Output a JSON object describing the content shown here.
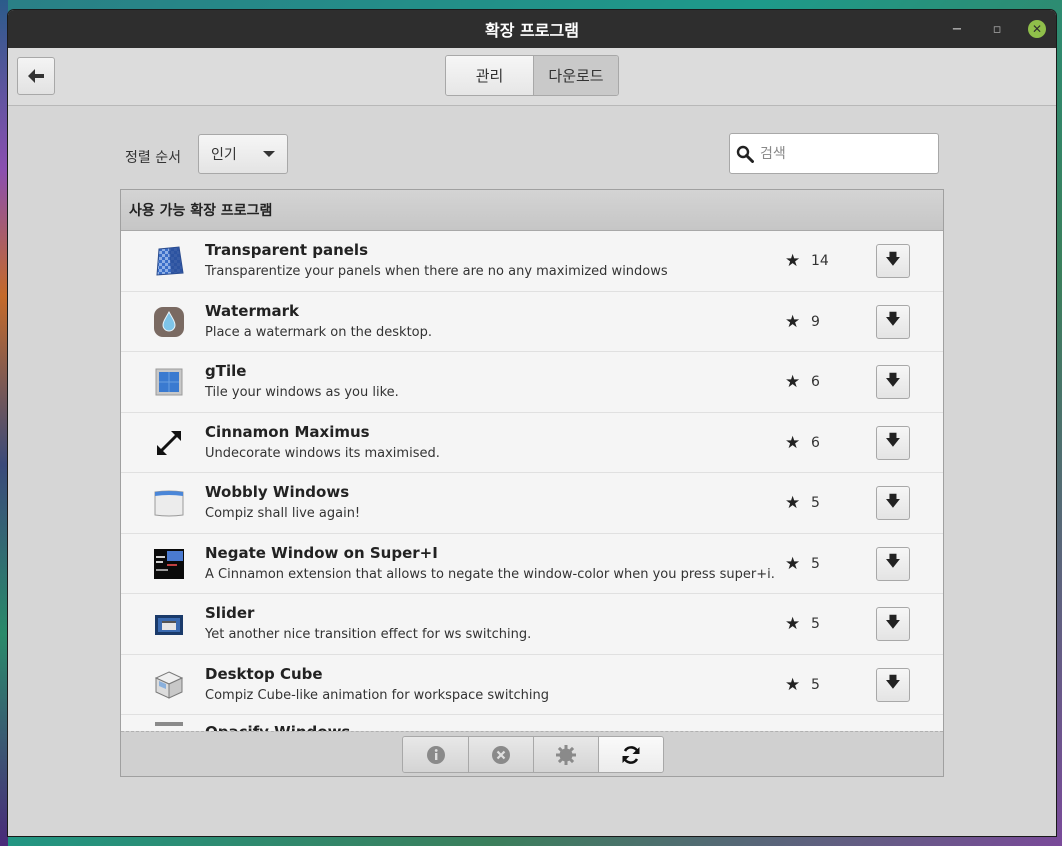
{
  "window": {
    "title": "확장 프로그램"
  },
  "window_controls": {
    "minimize": "−",
    "restore": "▫",
    "close": "✕"
  },
  "toolbar": {
    "back_icon": "arrow-left-icon",
    "tabs": [
      {
        "label": "관리",
        "active": false
      },
      {
        "label": "다운로드",
        "active": true
      }
    ]
  },
  "sort": {
    "label": "정렬 순서",
    "value": "인기"
  },
  "search": {
    "placeholder": "검색",
    "value": ""
  },
  "panel": {
    "header": "사용 가능 확장 프로그램",
    "items": [
      {
        "title": "Transparent panels",
        "description": "Transparentize your panels when there are no any maximized windows",
        "score": "14",
        "icon": "transparent-panels-icon"
      },
      {
        "title": "Watermark",
        "description": "Place a watermark on the desktop.",
        "score": "9",
        "icon": "watermark-icon"
      },
      {
        "title": "gTile",
        "description": "Tile your windows as you like.",
        "score": "6",
        "icon": "gtile-icon"
      },
      {
        "title": "Cinnamon Maximus",
        "description": "Undecorate windows its maximised.",
        "score": "6",
        "icon": "maximus-icon"
      },
      {
        "title": "Wobbly Windows",
        "description": "Compiz shall live again!",
        "score": "5",
        "icon": "wobbly-windows-icon"
      },
      {
        "title": "Negate Window on Super+I",
        "description": "A Cinnamon extension that allows to negate the window-color when you press super+i.",
        "score": "5",
        "icon": "negate-window-icon"
      },
      {
        "title": "Slider",
        "description": "Yet another nice transition effect for ws switching.",
        "score": "5",
        "icon": "slider-icon"
      },
      {
        "title": "Desktop Cube",
        "description": "Compiz Cube-like animation for workspace switching",
        "score": "5",
        "icon": "desktop-cube-icon"
      },
      {
        "title": "Opacify Windows",
        "description": "",
        "score": "",
        "icon": "opacify-windows-icon"
      }
    ]
  },
  "footer_buttons": [
    {
      "name": "info-button",
      "icon": "info-icon",
      "enabled": false
    },
    {
      "name": "remove-button",
      "icon": "remove-icon",
      "enabled": false
    },
    {
      "name": "configure-button",
      "icon": "gear-icon",
      "enabled": false
    },
    {
      "name": "refresh-button",
      "icon": "refresh-icon",
      "enabled": true
    }
  ],
  "colors": {
    "titlebar": "#2e2e2e",
    "close_button": "#8fbf4a",
    "panel_bg": "#f5f5f5"
  }
}
